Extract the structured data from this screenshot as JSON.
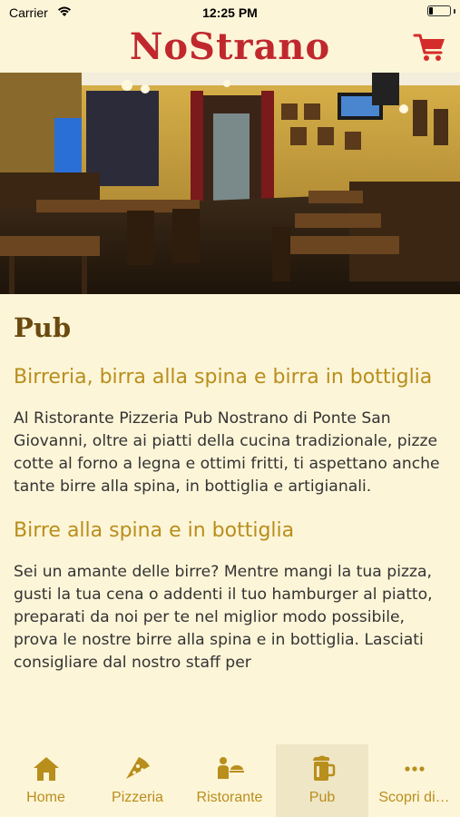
{
  "status_bar": {
    "carrier": "Carrier",
    "time": "12:25 PM",
    "battery_level": 0.2
  },
  "header": {
    "logo_text": "NoStrano"
  },
  "hero": {
    "image_icon": "pub-interior-photo"
  },
  "page": {
    "title": "Pub",
    "heading1": "Birreria, birra alla spina e birra in bottiglia",
    "paragraph1": "Al Ristorante Pizzeria Pub Nostrano di Ponte San Giovanni, oltre ai piatti della cucina tradizionale, pizze cotte al forno a legna e ottimi fritti, ti aspettano anche tante birre alla spina, in bottiglia e artigianali.",
    "heading2": "Birre alla spina e in bottiglia",
    "paragraph2": "Sei un amante delle birre? Mentre mangi la tua pizza, gusti la tua cena o addenti il tuo hamburger al piatto, preparati da noi per te nel miglior modo possibile, prova le nostre birre alla spina e in bottiglia. Lasciati consigliare dal nostro staff per"
  },
  "tabs": [
    {
      "label": "Home",
      "icon": "house-icon"
    },
    {
      "label": "Pizzeria",
      "icon": "pizza-icon"
    },
    {
      "label": "Ristorante",
      "icon": "waiter-icon"
    },
    {
      "label": "Pub",
      "icon": "beer-mug-icon",
      "active": true
    },
    {
      "label": "Scopri di…",
      "icon": "more-dots-icon"
    }
  ],
  "colors": {
    "background": "#fdf5d8",
    "accent_gold": "#b88e1c",
    "title_brown": "#6b4a10",
    "logo_red": "#c0282e",
    "cart_red": "#d42b2b"
  }
}
